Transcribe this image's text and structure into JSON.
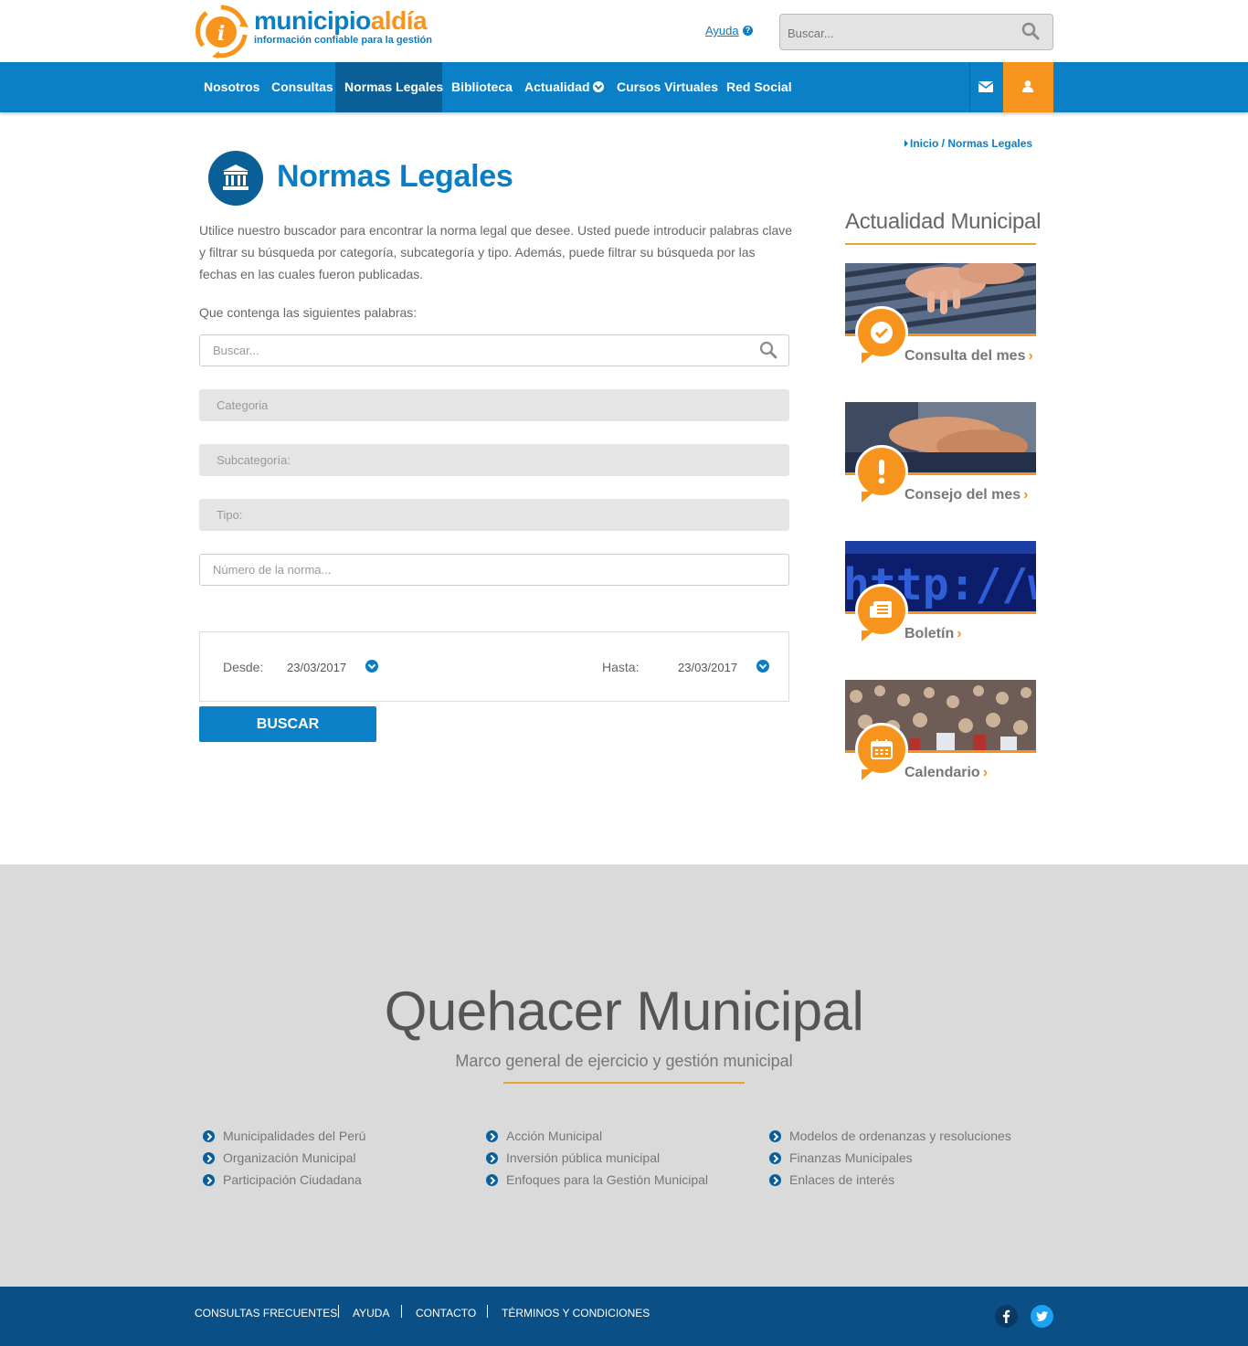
{
  "header": {
    "logo": {
      "name_part1": "municipio",
      "name_part2": "aldía",
      "tagline": "información confiable para la gestión"
    },
    "help_label": "Ayuda",
    "search_placeholder": "Buscar..."
  },
  "nav": {
    "items": [
      {
        "label": "Nosotros"
      },
      {
        "label": "Consultas"
      },
      {
        "label": "Normas Legales",
        "active": true
      },
      {
        "label": "Biblioteca"
      },
      {
        "label": "Actualidad"
      },
      {
        "label": "Cursos Virtuales"
      },
      {
        "label": "Red Social"
      }
    ]
  },
  "breadcrumb": {
    "text": "Inicio / Normas Legales"
  },
  "main": {
    "title": "Normas Legales",
    "intro": "Utilice nuestro buscador para encontrar la norma legal que desee. Usted puede introducir palabras clave y filtrar su búsqueda por categoría, subcategoría y tipo. Además, puede filtrar su búsqueda por las fechas en las cuales fueron publicadas.",
    "words_label": "Que contenga las siguientes palabras:",
    "search_placeholder": "Buscar...",
    "category_placeholder": "Categoria",
    "subcategory_placeholder": "Subcategoría:",
    "type_placeholder": "Tipo:",
    "number_placeholder": "Número de la norma...",
    "from_label": "Desde:",
    "from_value": "23/03/2017",
    "to_label": "Hasta:",
    "to_value": "23/03/2017",
    "submit_label": "BUSCAR"
  },
  "sidebar": {
    "title": "Actualidad Municipal",
    "cards": [
      {
        "label": "Consulta del mes",
        "icon": "check-icon"
      },
      {
        "label": "Consejo del mes",
        "icon": "exclamation-icon"
      },
      {
        "label": "Boletín",
        "icon": "newspaper-icon"
      },
      {
        "label": "Calendario",
        "icon": "calendar-icon"
      }
    ]
  },
  "quehacer": {
    "title": "Quehacer Municipal",
    "subtitle": "Marco general de ejercicio y gestión municipal",
    "columns": [
      [
        "Municipalidades del Perú",
        "Organización Municipal",
        "Participación Ciudadana"
      ],
      [
        "Acción Municipal",
        "Inversión pública municipal",
        "Enfoques para la Gestión Municipal"
      ],
      [
        "Modelos de ordenanzas y resoluciones",
        "Finanzas Municipales",
        "Enlaces de interés"
      ]
    ]
  },
  "footer": {
    "links": [
      "CONSULTAS FRECUENTES",
      "AYUDA",
      "CONTACTO",
      "TÉRMINOS Y CONDICIONES"
    ],
    "social": [
      {
        "name": "facebook-icon",
        "glyph": "f",
        "color": "#0a3a63"
      },
      {
        "name": "twitter-icon",
        "glyph": "t",
        "color": "#1da1f2"
      }
    ]
  },
  "colors": {
    "primary": "#0b80c6",
    "dark_blue": "#0a5f97",
    "accent": "#f7941d",
    "footer": "#0a4f85"
  }
}
